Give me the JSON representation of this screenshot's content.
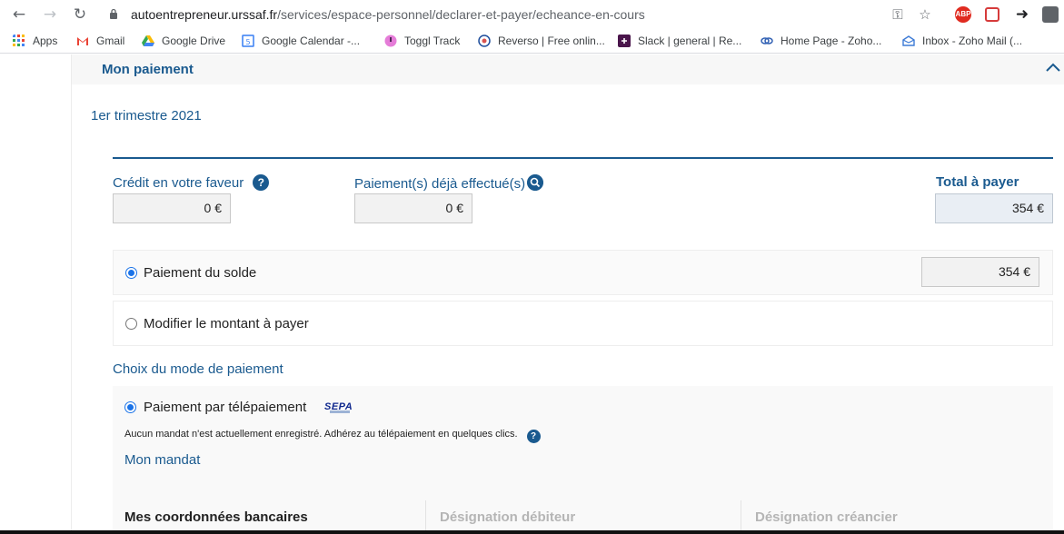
{
  "browser": {
    "url_host": "autoentrepreneur.urssaf.fr",
    "url_path": "/services/espace-personnel/declarer-et-payer/echeance-en-cours",
    "extensions": [
      "ABP"
    ],
    "bookmarks": [
      {
        "label": "Apps",
        "icon": "apps-grid-icon",
        "color": "#4285f4"
      },
      {
        "label": "Gmail",
        "icon": "gmail-icon",
        "color": "#ea4335"
      },
      {
        "label": "Google Drive",
        "icon": "google-drive-icon",
        "color": "#fbbc04"
      },
      {
        "label": "Google Calendar -...",
        "icon": "google-calendar-icon",
        "color": "#4285f4"
      },
      {
        "label": "Toggl Track",
        "icon": "toggl-icon",
        "color": "#e57cd8"
      },
      {
        "label": "Reverso | Free onlin...",
        "icon": "reverso-icon",
        "color": "#1f4e9c"
      },
      {
        "label": "Slack | general | Re...",
        "icon": "slack-icon",
        "color": "#4a154b"
      },
      {
        "label": "Home Page - Zoho...",
        "icon": "zoho-icon",
        "color": "#2f5fb3"
      },
      {
        "label": "Inbox - Zoho Mail (...",
        "icon": "zoho-mail-icon",
        "color": "#3d7bd6"
      }
    ]
  },
  "section": {
    "title": "Mon paiement",
    "period": "1er trimestre 2021"
  },
  "summary": {
    "credit_label": "Crédit en votre faveur",
    "credit_value": "0 €",
    "paid_label": "Paiement(s) déjà effectué(s)",
    "paid_value": "0 €",
    "total_label": "Total à payer",
    "total_value": "354 €"
  },
  "options": {
    "balance_label": "Paiement du solde",
    "balance_value": "354 €",
    "modify_label": "Modifier le montant à payer",
    "selected": "balance"
  },
  "payment_mode": {
    "title": "Choix du mode de paiement",
    "teleprepayment_label": "Paiement par télépaiement",
    "sepa_logo_text": "SEPA",
    "mandate_text": "Aucun mandat n'est actuellement enregistré. Adhérez au télépaiement en quelques clics.",
    "mandate_link": "Mon mandat"
  },
  "bank_table": {
    "columns": [
      "Mes coordonnées bancaires",
      "Désignation débiteur",
      "Désignation créancier"
    ]
  },
  "colors": {
    "accent": "#1a5a8f",
    "radio": "#1a73e8"
  }
}
